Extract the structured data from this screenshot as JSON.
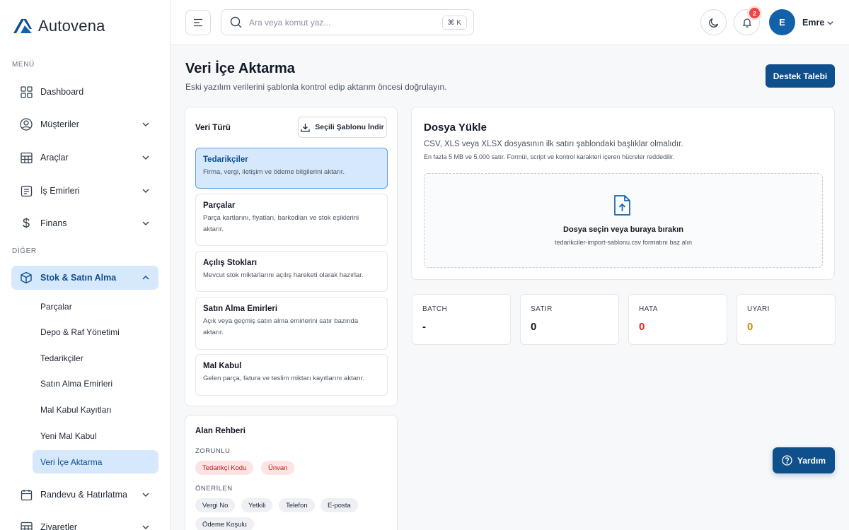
{
  "brand": {
    "name": "Autovena",
    "accent": "#0f4f8c"
  },
  "sidebar": {
    "menu_label": "MENÜ",
    "other_label": "DİĞER",
    "items": [
      {
        "label": "Dashboard",
        "icon": "grid-icon"
      },
      {
        "label": "Müşteriler",
        "icon": "user-circle-icon"
      },
      {
        "label": "Araçlar",
        "icon": "table-icon"
      },
      {
        "label": "İş Emirleri",
        "icon": "document-list-icon"
      },
      {
        "label": "Finans",
        "icon": "dollar-icon"
      },
      {
        "label": "Stok & Satın Alma",
        "icon": "box-icon"
      },
      {
        "label": "Randevu & Hatırlatma",
        "icon": "calendar-icon"
      },
      {
        "label": "Ziyaretler",
        "icon": "table-icon"
      }
    ],
    "sub_items": [
      {
        "label": "Parçalar"
      },
      {
        "label": "Depo & Raf Yönetimi"
      },
      {
        "label": "Tedarikçiler"
      },
      {
        "label": "Satın Alma Emirleri"
      },
      {
        "label": "Mal Kabul Kayıtları"
      },
      {
        "label": "Yeni Mal Kabul"
      },
      {
        "label": "Veri İçe Aktarma"
      }
    ]
  },
  "header": {
    "search_placeholder": "Ara veya komut yaz...",
    "shortcut": "⌘ K",
    "notification_count": "2",
    "avatar_initial": "E",
    "user_name": "Emre"
  },
  "page": {
    "title": "Veri İçe Aktarma",
    "subtitle": "Eski yazılım verilerini şablonla kontrol edip aktarım öncesi doğrulayın.",
    "support_button": "Destek Talebi"
  },
  "data_types": {
    "title": "Veri Türü",
    "download_button": "Seçili Şablonu İndir",
    "items": [
      {
        "title": "Tedarikçiler",
        "desc": "Firma, vergi, iletişim ve ödeme bilgilerini aktarır."
      },
      {
        "title": "Parçalar",
        "desc": "Parça kartlarını, fiyatları, barkodları ve stok eşiklerini aktarır."
      },
      {
        "title": "Açılış Stokları",
        "desc": "Mevcut stok miktarlarını açılış hareketi olarak hazırlar."
      },
      {
        "title": "Satın Alma Emirleri",
        "desc": "Açık veya geçmiş satın alma emirlerini satır bazında aktarır."
      },
      {
        "title": "Mal Kabul",
        "desc": "Gelen parça, fatura ve teslim miktarı kayıtlarını aktarır."
      }
    ]
  },
  "field_guide": {
    "title": "Alan Rehberi",
    "required_label": "ZORUNLU",
    "required": [
      "Tedarikçi Kodu",
      "Ünvan"
    ],
    "suggested_label": "ÖNERİLEN",
    "suggested": [
      "Vergi No",
      "Yetkili",
      "Telefon",
      "E-posta",
      "Ödeme Koşulu"
    ]
  },
  "upload": {
    "title": "Dosya Yükle",
    "description": "CSV, XLS veya XLSX dosyasının ilk satırı şablondaki başlıklar olmalıdır.",
    "note": "En fazla 5 MB ve 5.000 satır. Formül, script ve kontrol karakteri içeren hücreler reddedilir.",
    "drop_title": "Dosya seçin veya buraya bırakın",
    "drop_hint": "tedarikciler-import-sablonu.csv formatını baz alın"
  },
  "stats": [
    {
      "label": "BATCH",
      "value": "-",
      "color": "#111827"
    },
    {
      "label": "SATIR",
      "value": "0",
      "color": "#111827"
    },
    {
      "label": "HATA",
      "value": "0",
      "color": "#dc2626"
    },
    {
      "label": "UYARI",
      "value": "0",
      "color": "#ca8a04"
    }
  ],
  "help_button": "Yardım"
}
